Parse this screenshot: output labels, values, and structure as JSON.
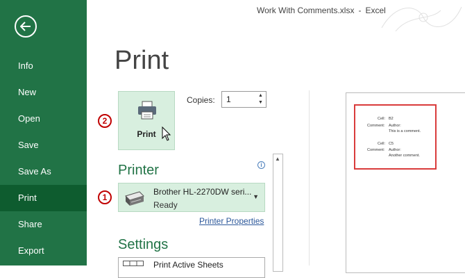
{
  "window": {
    "title_file": "Work With Comments.xlsx",
    "title_sep": "-",
    "title_app": "Excel"
  },
  "sidebar": {
    "back_icon": "arrow-left-icon",
    "items": [
      {
        "label": "Info",
        "active": false
      },
      {
        "label": "New",
        "active": false
      },
      {
        "label": "Open",
        "active": false
      },
      {
        "label": "Save",
        "active": false
      },
      {
        "label": "Save As",
        "active": false
      },
      {
        "label": "Print",
        "active": true
      },
      {
        "label": "Share",
        "active": false
      },
      {
        "label": "Export",
        "active": false
      }
    ]
  },
  "main": {
    "page_title": "Print",
    "print_button": {
      "label": "Print",
      "icon": "printer-icon",
      "badge": "2"
    },
    "copies": {
      "label": "Copies:",
      "value": "1"
    },
    "printer": {
      "heading": "Printer",
      "info_icon": "i",
      "name": "Brother HL-2270DW seri...",
      "status": "Ready",
      "badge": "1",
      "properties_link": "Printer Properties"
    },
    "settings": {
      "heading": "Settings",
      "first_option": "Print Active Sheets"
    }
  },
  "preview": {
    "comments": [
      {
        "cell_label": "Cell:",
        "cell": "B2",
        "comment_label": "Comment:",
        "author": "Author:",
        "text": "This is a comment."
      },
      {
        "cell_label": "Cell:",
        "cell": "C5",
        "comment_label": "Comment:",
        "author": "Author:",
        "text": "Another comment."
      }
    ]
  },
  "colors": {
    "brand": "#217346",
    "active": "#0e5c2f",
    "highlight": "#d8efdf",
    "badge": "#c00000",
    "box": "#d93b3b"
  }
}
